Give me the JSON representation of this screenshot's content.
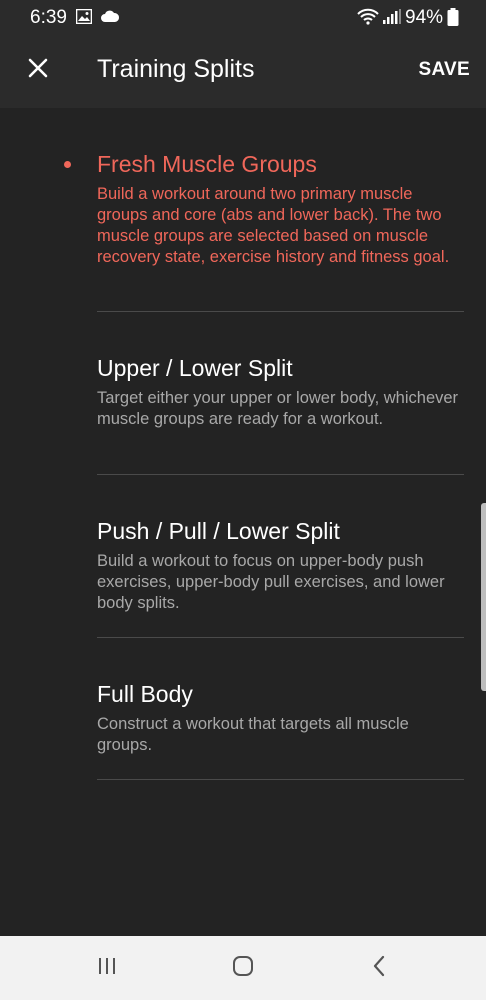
{
  "status_bar": {
    "time": "6:39",
    "battery": "94%",
    "icons": [
      "image-icon",
      "cloud-icon",
      "wifi-icon",
      "signal-icon",
      "battery-icon"
    ]
  },
  "app_bar": {
    "title": "Training Splits",
    "save_label": "SAVE",
    "close_icon": "close-icon"
  },
  "colors": {
    "accent": "#f0675a",
    "background": "#232323",
    "bar": "#2b2b2b",
    "nav_bar": "#f2f2f2"
  },
  "options": [
    {
      "title": "Fresh Muscle Groups",
      "description": "Build a workout around two primary muscle groups and core (abs and lower back). The two muscle groups are selected based on muscle recovery state, exercise history and fitness goal.",
      "selected": true
    },
    {
      "title": "Upper / Lower Split",
      "description": "Target either your upper or lower body, whichever muscle groups are ready for a workout.",
      "selected": false
    },
    {
      "title": "Push / Pull / Lower Split",
      "description": "Build a workout to focus on upper-body push exercises, upper-body pull exercises, and lower body splits.",
      "selected": false
    },
    {
      "title": "Full Body",
      "description": "Construct a workout that targets all muscle groups.",
      "selected": false
    }
  ],
  "nav_bar": {
    "icons": [
      "recent-apps-icon",
      "home-icon",
      "back-icon"
    ]
  }
}
